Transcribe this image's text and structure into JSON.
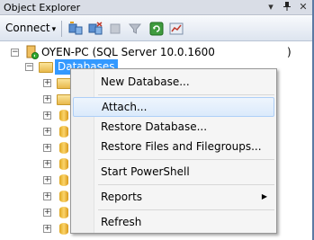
{
  "window": {
    "title": "Object Explorer",
    "pin_glyph": "↓ 0",
    "dropdown_glyph": "▾",
    "pin_icon": "pin-icon",
    "close_glyph": "✕"
  },
  "toolbar": {
    "connect_label": "Connect",
    "connect_arrow": "▾"
  },
  "tree": {
    "server_label": "OYEN-PC (SQL Server 10.0.1600",
    "server_trailing": ")",
    "databases_label": "Databases"
  },
  "context_menu": {
    "items": [
      {
        "label": "New Database..."
      },
      {
        "label": "Attach..."
      },
      {
        "label": "Restore Database..."
      },
      {
        "label": "Restore Files and Filegroups..."
      },
      {
        "label": "Start PowerShell"
      },
      {
        "label": "Reports"
      },
      {
        "label": "Refresh"
      }
    ],
    "highlighted_item": "Attach...",
    "submenu_arrow": "▶"
  },
  "colors": {
    "selection": "#3399ff",
    "menu_highlight_border": "#aecff7"
  }
}
